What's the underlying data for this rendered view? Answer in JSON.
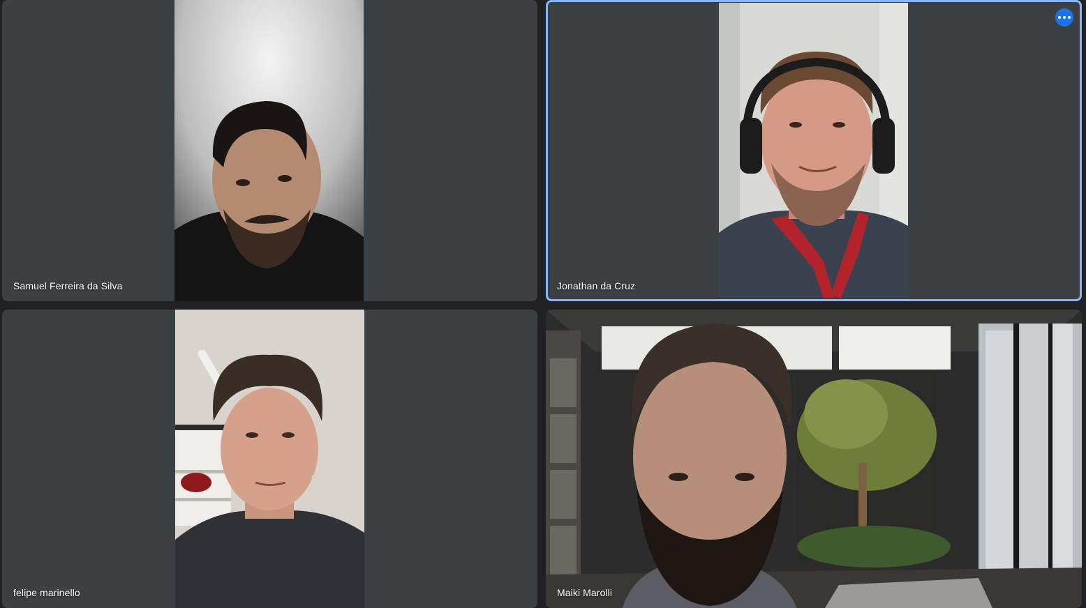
{
  "meeting": {
    "participants": [
      {
        "name": "Samuel Ferreira da Silva",
        "active_speaker": false
      },
      {
        "name": "Jonathan da Cruz",
        "active_speaker": true
      },
      {
        "name": "felipe marinello",
        "active_speaker": false
      },
      {
        "name": "Maiki Marolli",
        "active_speaker": false
      }
    ],
    "more_options_icon": "more-horizontal-icon"
  },
  "colors": {
    "tile_background": "#3c4043",
    "page_background": "#202124",
    "active_speaker_border": "#8ab4f8",
    "more_options_button": "#1a73e8"
  }
}
